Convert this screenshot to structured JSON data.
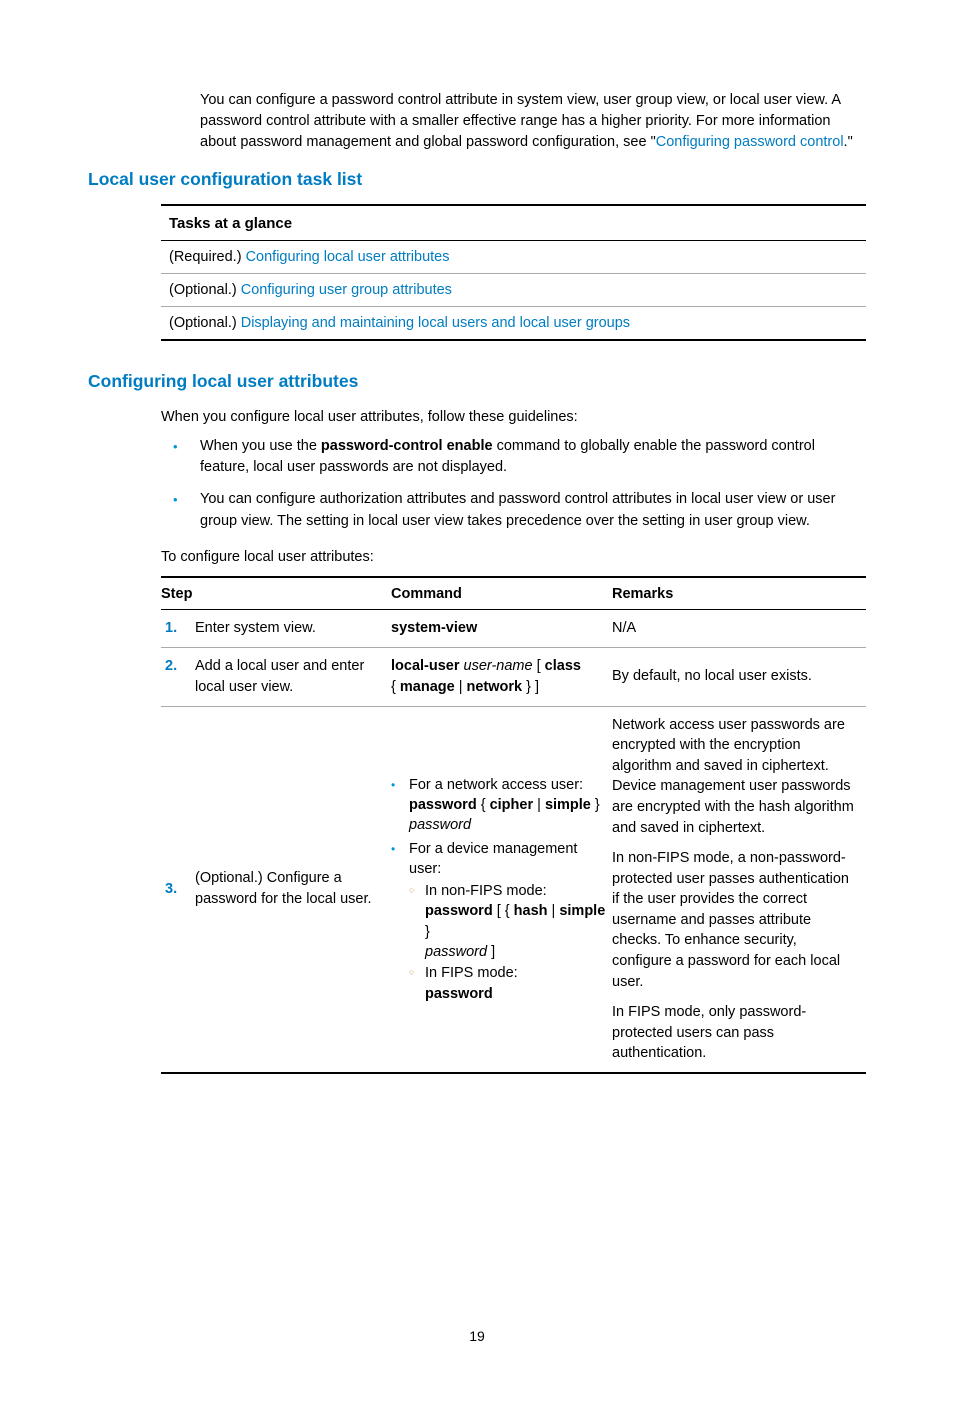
{
  "intro": {
    "text1": "You can configure a password control attribute in system view, user group view, or local user view. A password control attribute with a smaller effective range has a higher priority. For more information about password management and global password configuration, see \"",
    "link": "Configuring password control",
    "text2": ".\""
  },
  "heading1": "Local user configuration task list",
  "tasks": {
    "header": "Tasks at a glance",
    "rows": [
      {
        "prefix": "(Required.) ",
        "link": "Configuring local user attributes"
      },
      {
        "prefix": "(Optional.) ",
        "link": "Configuring user group attributes"
      },
      {
        "prefix": "(Optional.) ",
        "link": "Displaying and maintaining local users and local user groups"
      }
    ]
  },
  "heading2": "Configuring local user attributes",
  "lead": "When you configure local user attributes, follow these guidelines:",
  "bullets": {
    "b1a": "When you use the ",
    "b1bold": "password-control enable",
    "b1b": " command to globally enable the password control feature, local user passwords are not displayed.",
    "b2": "You can configure authorization attributes and password control attributes in local user view or user group view. The setting in local user view takes precedence over the setting in user group view."
  },
  "lead2": "To configure local user attributes:",
  "steps": {
    "hStep": "Step",
    "hCmd": "Command",
    "hRem": "Remarks",
    "r1": {
      "n": "1.",
      "step": "Enter system view.",
      "cmd": "system-view",
      "rem": "N/A"
    },
    "r2": {
      "n": "2.",
      "step": "Add a local user and enter local user view.",
      "cmd_b1": "local-user",
      "cmd_i1": " user-name ",
      "cmd_t1": "[ ",
      "cmd_b2": "class",
      "cmd_t2": " { ",
      "cmd_b3": "manage",
      "cmd_t3": " | ",
      "cmd_b4": "network",
      "cmd_t4": " } ]",
      "rem": "By default, no local user exists."
    },
    "r3": {
      "n": "3.",
      "step": "(Optional.) Configure a password for the local user.",
      "li1": "For a network access user:",
      "li1_b1": "password",
      "li1_t1": " { ",
      "li1_b2": "cipher",
      "li1_t2": " | ",
      "li1_b3": "simple",
      "li1_t3": " } ",
      "li1_i1": "password",
      "li2": "For a device management user:",
      "sub1": "In non-FIPS mode:",
      "sub1_b1": "password",
      "sub1_t1": " [ { ",
      "sub1_b2": "hash",
      "sub1_t2": " | ",
      "sub1_b3": "simple",
      "sub1_t3": " } ",
      "sub1_i1": "password",
      "sub1_t4": " ]",
      "sub2": "In FIPS mode:",
      "sub2_b1": "password",
      "rem_p1": "Network access user passwords are encrypted with the encryption algorithm and saved in ciphertext. Device management user passwords are encrypted with the hash algorithm and saved in ciphertext.",
      "rem_p2": "In non-FIPS mode, a non-password-protected user passes authentication if the user provides the correct username and passes attribute checks. To enhance security, configure a password for each local user.",
      "rem_p3": "In FIPS mode, only password-protected users can pass authentication."
    }
  },
  "pagenum": "19"
}
